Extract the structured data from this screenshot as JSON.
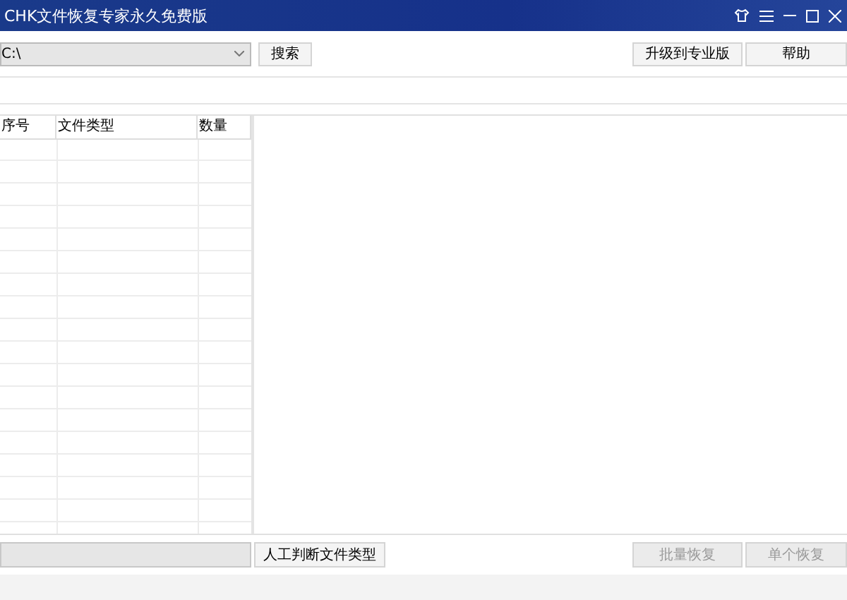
{
  "window": {
    "title": "CHK文件恢复专家永久免费版"
  },
  "toolbar": {
    "drive": {
      "value": "C:\\"
    },
    "buttons": [
      {
        "label": "搜索",
        "disabled": false
      },
      {
        "label": "升级到专业版",
        "disabled": false
      },
      {
        "label": "帮助",
        "disabled": false
      }
    ]
  },
  "table": {
    "columns": [
      "序号",
      "文件类型",
      "数量"
    ]
  },
  "bottom": {
    "buttons": [
      {
        "label": "人工判断文件类型",
        "disabled": false
      },
      {
        "label": "批量恢复",
        "disabled": true
      },
      {
        "label": "单个恢复",
        "disabled": true
      }
    ]
  }
}
